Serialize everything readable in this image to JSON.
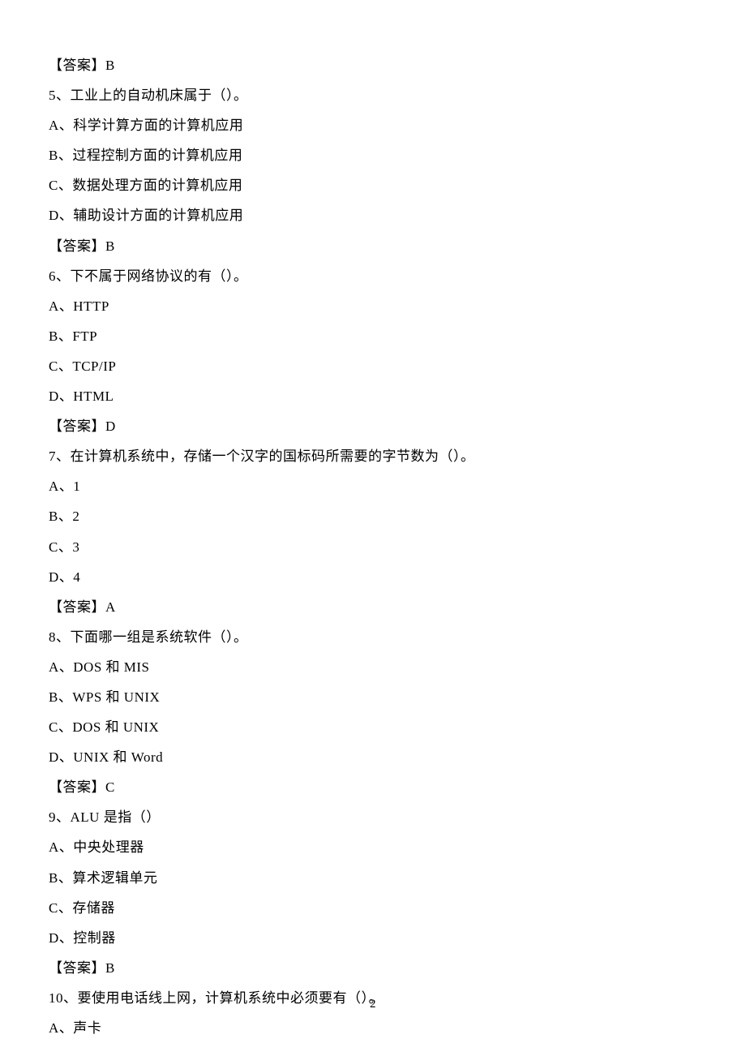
{
  "lines": [
    "【答案】B",
    "5、工业上的自动机床属于（）。",
    "A、科学计算方面的计算机应用",
    "B、过程控制方面的计算机应用",
    "C、数据处理方面的计算机应用",
    "D、辅助设计方面的计算机应用",
    "【答案】B",
    "6、下不属于网络协议的有（）。",
    "A、HTTP",
    "B、FTP",
    "C、TCP/IP",
    "D、HTML",
    "【答案】D",
    "7、在计算机系统中，存储一个汉字的国标码所需要的字节数为（）。",
    "A、1",
    "B、2",
    "C、3",
    "D、4",
    "【答案】A",
    "8、下面哪一组是系统软件（）。",
    "A、DOS 和 MIS",
    "B、WPS 和 UNIX",
    "C、DOS 和 UNIX",
    "D、UNIX 和 Word",
    "【答案】C",
    "9、ALU 是指（）",
    "A、中央处理器",
    "B、算术逻辑单元",
    "C、存储器",
    "D、控制器",
    "【答案】B",
    "10、要使用电话线上网，计算机系统中必须要有（）。",
    "A、声卡"
  ],
  "page_number": "2"
}
